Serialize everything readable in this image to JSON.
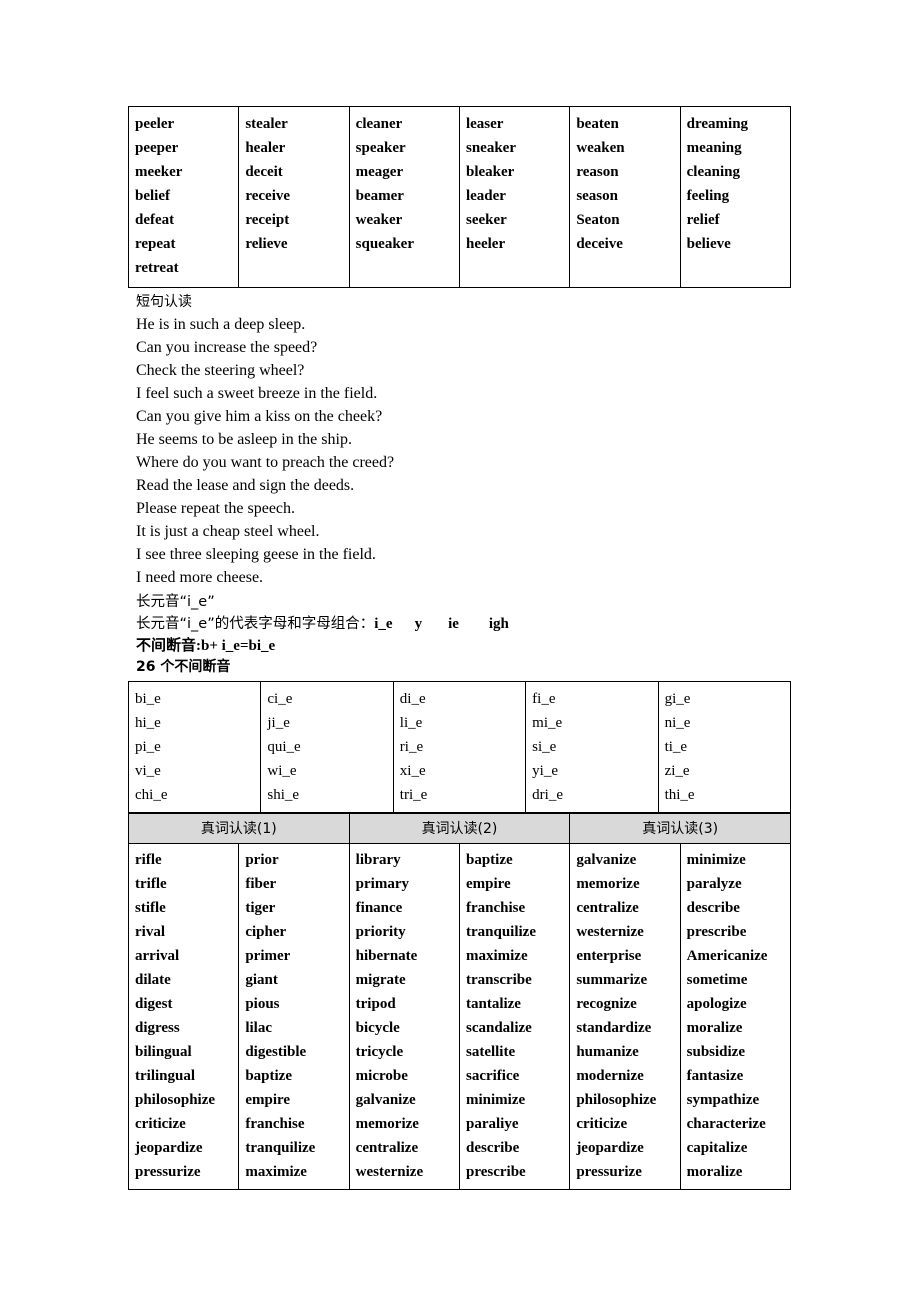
{
  "tables": {
    "long_e_words": {
      "name": "long-e-word-table",
      "columns": [
        [
          "peeler",
          "peeper",
          "meeker",
          "belief",
          "defeat",
          "repeat",
          "retreat"
        ],
        [
          "stealer",
          "healer",
          "deceit",
          "receive",
          "receipt",
          "relieve"
        ],
        [
          "cleaner",
          "speaker",
          "meager",
          "beamer",
          "weaker",
          "squeaker"
        ],
        [
          "leaser",
          "sneaker",
          "bleaker",
          "leader",
          "seeker",
          "heeler"
        ],
        [
          "beaten",
          "weaken",
          "reason",
          "season",
          "Seaton",
          "deceive"
        ],
        [
          "dreaming",
          "meaning",
          "cleaning",
          "feeling",
          "relief",
          "believe"
        ]
      ]
    },
    "ie_syllables": {
      "name": "ie-syllable-table",
      "columns": [
        [
          "bi_e",
          "hi_e",
          "pi_e",
          "vi_e",
          "chi_e"
        ],
        [
          "ci_e",
          "ji_e",
          "qui_e",
          "wi_e",
          "shi_e"
        ],
        [
          "di_e",
          "li_e",
          "ri_e",
          "xi_e",
          "tri_e"
        ],
        [
          "fi_e",
          "mi_e",
          "si_e",
          "yi_e",
          "dri_e"
        ],
        [
          "gi_e",
          "ni_e",
          "ti_e",
          "zi_e",
          "thi_e"
        ]
      ]
    },
    "real_words": {
      "name": "real-word-table",
      "headers": [
        "真词认读(1)",
        "真词认读(2)",
        "真词认读(3)"
      ],
      "columns": [
        [
          "rifle",
          "trifle",
          "stifle",
          "rival",
          "arrival",
          "dilate",
          "digest",
          "digress",
          "bilingual",
          "trilingual",
          "philosophize",
          "criticize",
          "jeopardize",
          "pressurize"
        ],
        [
          "prior",
          "fiber",
          "tiger",
          "cipher",
          "primer",
          "giant",
          "pious",
          "lilac",
          "digestible",
          "baptize",
          "empire",
          "franchise",
          "tranquilize",
          "maximize"
        ],
        [
          "library",
          "primary",
          "finance",
          "priority",
          "hibernate",
          "migrate",
          "tripod",
          "bicycle",
          "tricycle",
          "microbe",
          "galvanize",
          "memorize",
          "centralize",
          "westernize"
        ],
        [
          "baptize",
          "empire",
          "franchise",
          "tranquilize",
          "maximize",
          "transcribe",
          "tantalize",
          "scandalize",
          "satellite",
          "sacrifice",
          "minimize",
          "paraliye",
          "describe",
          "prescribe"
        ],
        [
          "galvanize",
          "memorize",
          "centralize",
          "westernize",
          "enterprise",
          "summarize",
          "recognize",
          "standardize",
          "humanize",
          "modernize",
          "philosophize",
          "criticize",
          "jeopardize",
          "pressurize"
        ],
        [
          "minimize",
          "paralyze",
          "describe",
          "prescribe",
          "Americanize",
          "sometime",
          "apologize",
          "moralize",
          "subsidize",
          "fantasize",
          "sympathize",
          "characterize",
          "capitalize",
          "moralize"
        ]
      ]
    }
  },
  "sections": {
    "short_sentences_heading": "短句认读",
    "sentences": [
      "He is in such a deep sleep.",
      "Can you increase the speed?",
      "Check the steering wheel?",
      "I feel such a sweet breeze in the field.",
      "Can you give him a kiss on the cheek?",
      "He seems to be asleep in the ship.",
      "Where do you want to preach the creed?",
      "Read the lease and sign the deeds.",
      "Please repeat the speech.",
      "It is just a cheap steel wheel.",
      "I see three sleeping geese in the field.",
      "I need more cheese."
    ],
    "long_vowel_title": "长元音“i_e”",
    "letters_line_prefix": "长元音“i_e”的代表字母和字母组合：",
    "letters": [
      "i_e",
      "y",
      "ie",
      "igh"
    ],
    "unbroken_line": "不间断音:b+ i_e=bi_e",
    "count_line": "26 个不间断音"
  },
  "colors": {
    "header_shade": "#d9d9d9",
    "border": "#000000",
    "text": "#000000",
    "page_background": "#ffffff"
  }
}
